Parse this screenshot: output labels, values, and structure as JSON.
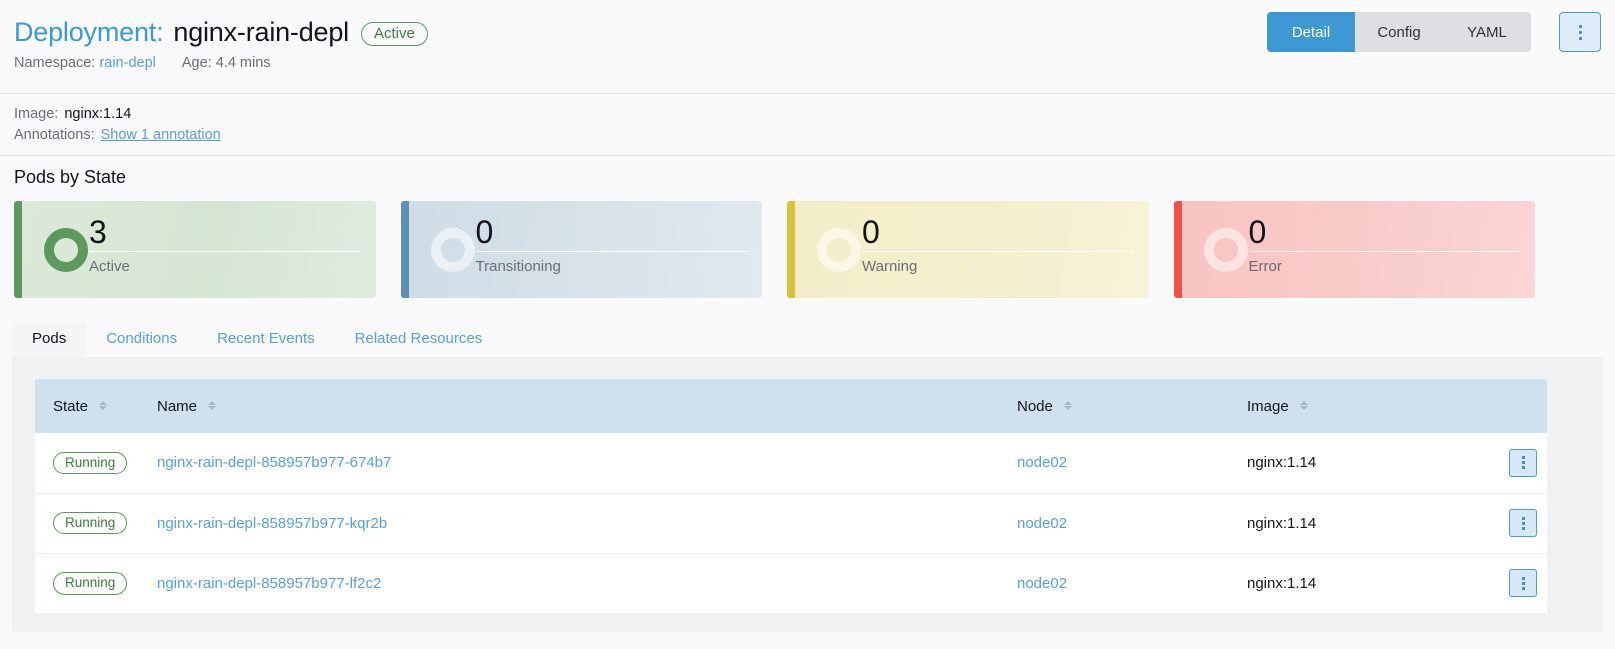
{
  "header": {
    "kind_label": "Deployment:",
    "resource_name": "nginx-rain-depl",
    "state_badge": "Active",
    "namespace_label": "Namespace:",
    "namespace_value": "rain-depl",
    "age_label": "Age:",
    "age_value": "4.4 mins",
    "view_tabs": [
      {
        "label": "Detail",
        "active": true
      },
      {
        "label": "Config",
        "active": false
      },
      {
        "label": "YAML",
        "active": false
      }
    ],
    "actions_icon": "kebab-menu-icon"
  },
  "info": {
    "image_label": "Image:",
    "image_value": "nginx:1.14",
    "annotations_label": "Annotations:",
    "annotations_link": "Show 1 annotation"
  },
  "pods_by_state": {
    "title": "Pods by State",
    "cards": [
      {
        "count": "3",
        "label": "Active",
        "variant": "active",
        "accent": "#5d995d"
      },
      {
        "count": "0",
        "label": "Transitioning",
        "variant": "transitioning",
        "accent": "#5f8fb5"
      },
      {
        "count": "0",
        "label": "Warning",
        "variant": "warning",
        "accent": "#d9c33c"
      },
      {
        "count": "0",
        "label": "Error",
        "variant": "error",
        "accent": "#f2504a"
      }
    ]
  },
  "tabs": [
    {
      "label": "Pods",
      "active": true
    },
    {
      "label": "Conditions",
      "active": false
    },
    {
      "label": "Recent Events",
      "active": false
    },
    {
      "label": "Related Resources",
      "active": false
    }
  ],
  "pods_table": {
    "columns": [
      {
        "label": "State",
        "sortable": true
      },
      {
        "label": "Name",
        "sortable": true
      },
      {
        "label": "Node",
        "sortable": true
      },
      {
        "label": "Image",
        "sortable": true
      }
    ],
    "rows": [
      {
        "state": "Running",
        "name": "nginx-rain-depl-858957b977-674b7",
        "node": "node02",
        "image": "nginx:1.14",
        "actions_icon": "kebab-menu-icon"
      },
      {
        "state": "Running",
        "name": "nginx-rain-depl-858957b977-kqr2b",
        "node": "node02",
        "image": "nginx:1.14",
        "actions_icon": "kebab-menu-icon"
      },
      {
        "state": "Running",
        "name": "nginx-rain-depl-858957b977-lf2c2",
        "node": "node02",
        "image": "nginx:1.14",
        "actions_icon": "kebab-menu-icon"
      }
    ]
  },
  "colors": {
    "brand_blue": "#3d98d3",
    "link_blue": "#5b9ed6",
    "table_header_blue": "#cfe0ee",
    "panel_grey": "#f0f1f3",
    "page_bg": "#fafafc"
  }
}
